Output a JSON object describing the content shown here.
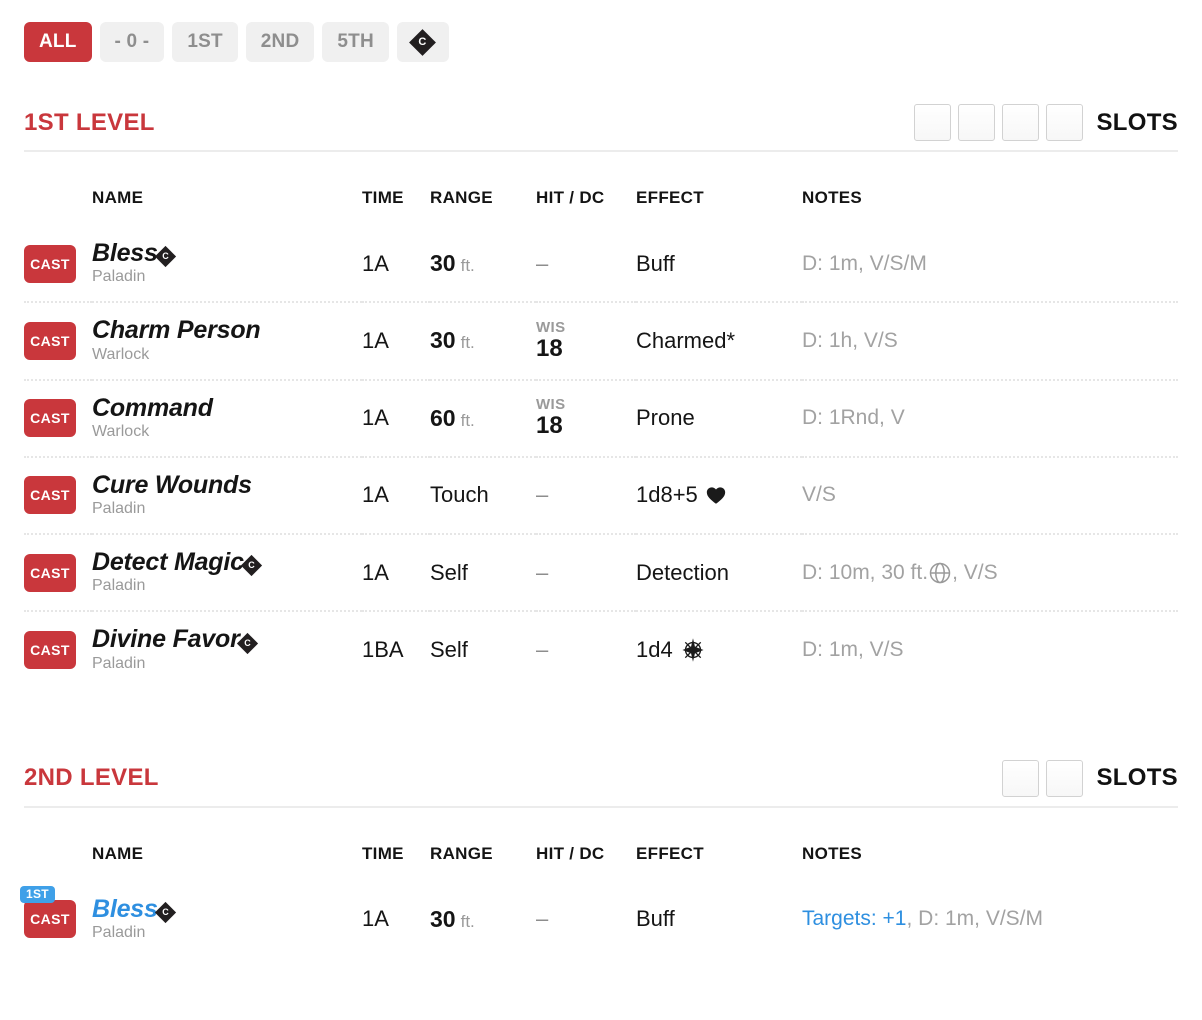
{
  "filters": [
    {
      "label": "ALL",
      "active": true,
      "type": "text",
      "name": "filter-all"
    },
    {
      "label": "- 0 -",
      "active": false,
      "type": "text",
      "name": "filter-cantrip"
    },
    {
      "label": "1ST",
      "active": false,
      "type": "text",
      "name": "filter-1st"
    },
    {
      "label": "2ND",
      "active": false,
      "type": "text",
      "name": "filter-2nd"
    },
    {
      "label": "5TH",
      "active": false,
      "type": "text",
      "name": "filter-5th"
    },
    {
      "label": "C",
      "active": false,
      "type": "concentration",
      "name": "filter-concentration"
    }
  ],
  "colors": {
    "accent_red": "#c9373c",
    "upcast_blue": "#2e8fe0",
    "badge_blue": "#3fa0e8",
    "muted_gray": "#9a9a9a",
    "notes_gray": "#a2a2a2"
  },
  "table_headers": {
    "name": "NAME",
    "time": "TIME",
    "range": "RANGE",
    "hit_dc": "HIT / DC",
    "effect": "EFFECT",
    "notes": "NOTES"
  },
  "cast_label": "CAST",
  "slots_label": "SLOTS",
  "sections": [
    {
      "title": "1ST LEVEL",
      "slot_count": 4,
      "slots_filled": 0,
      "spells": [
        {
          "name": "Bless",
          "source": "Paladin",
          "concentration": true,
          "upcast_badge": null,
          "time": "1A",
          "range_num": "30",
          "range_unit": "ft.",
          "range_plain": null,
          "hit_dc_ability": null,
          "hit_dc_value": "–",
          "effect": "Buff",
          "effect_icon": null,
          "notes": "D: 1m, V/S/M",
          "notes_upcast": null,
          "notes_icon": null
        },
        {
          "name": "Charm Person",
          "source": "Warlock",
          "concentration": false,
          "upcast_badge": null,
          "time": "1A",
          "range_num": "30",
          "range_unit": "ft.",
          "range_plain": null,
          "hit_dc_ability": "WIS",
          "hit_dc_value": "18",
          "effect": "Charmed*",
          "effect_icon": null,
          "notes": "D: 1h, V/S",
          "notes_upcast": null,
          "notes_icon": null
        },
        {
          "name": "Command",
          "source": "Warlock",
          "concentration": false,
          "upcast_badge": null,
          "time": "1A",
          "range_num": "60",
          "range_unit": "ft.",
          "range_plain": null,
          "hit_dc_ability": "WIS",
          "hit_dc_value": "18",
          "effect": "Prone",
          "effect_icon": null,
          "notes": "D: 1Rnd, V",
          "notes_upcast": null,
          "notes_icon": null
        },
        {
          "name": "Cure Wounds",
          "source": "Paladin",
          "concentration": false,
          "upcast_badge": null,
          "time": "1A",
          "range_num": null,
          "range_unit": null,
          "range_plain": "Touch",
          "hit_dc_ability": null,
          "hit_dc_value": "–",
          "effect": "1d8+5",
          "effect_icon": "heart-icon",
          "notes": "V/S",
          "notes_upcast": null,
          "notes_icon": null
        },
        {
          "name": "Detect Magic",
          "source": "Paladin",
          "concentration": true,
          "upcast_badge": null,
          "time": "1A",
          "range_num": null,
          "range_unit": null,
          "range_plain": "Self",
          "hit_dc_ability": null,
          "hit_dc_value": "–",
          "effect": "Detection",
          "effect_icon": null,
          "notes": "D: 10m, 30 ft.",
          "notes_upcast": null,
          "notes_icon": "sphere-icon",
          "notes_after_icon": ", V/S"
        },
        {
          "name": "Divine Favor",
          "source": "Paladin",
          "concentration": true,
          "upcast_badge": null,
          "time": "1BA",
          "range_num": null,
          "range_unit": null,
          "range_plain": "Self",
          "hit_dc_ability": null,
          "hit_dc_value": "–",
          "effect": "1d4",
          "effect_icon": "radiant-icon",
          "notes": "D: 1m, V/S",
          "notes_upcast": null,
          "notes_icon": null
        }
      ]
    },
    {
      "title": "2ND LEVEL",
      "slot_count": 2,
      "slots_filled": 0,
      "spells": [
        {
          "name": "Bless",
          "source": "Paladin",
          "concentration": true,
          "upcast_badge": "1ST",
          "upcast": true,
          "time": "1A",
          "range_num": "30",
          "range_unit": "ft.",
          "range_plain": null,
          "hit_dc_ability": null,
          "hit_dc_value": "–",
          "effect": "Buff",
          "effect_icon": null,
          "notes": ", D: 1m, V/S/M",
          "notes_upcast": "Targets: +1",
          "notes_icon": null
        }
      ]
    }
  ]
}
